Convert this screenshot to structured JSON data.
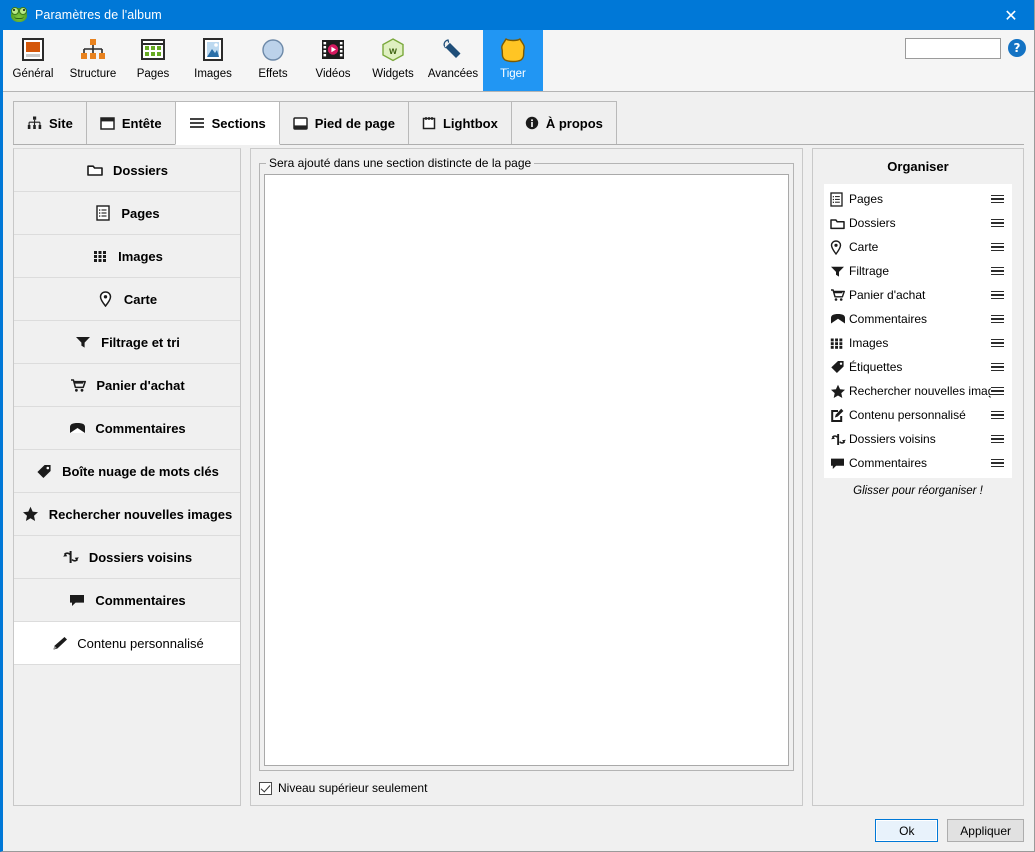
{
  "window": {
    "title": "Paramètres de l'album",
    "icon": "frog-icon",
    "close_label": "✕"
  },
  "toolbar": {
    "items": [
      {
        "label": "Général",
        "icon": "general-icon",
        "active": false
      },
      {
        "label": "Structure",
        "icon": "structure-icon",
        "active": false
      },
      {
        "label": "Pages",
        "icon": "pages-grid-icon",
        "active": false
      },
      {
        "label": "Images",
        "icon": "image-icon",
        "active": false
      },
      {
        "label": "Effets",
        "icon": "circle-icon",
        "active": false
      },
      {
        "label": "Vidéos",
        "icon": "film-icon",
        "active": false
      },
      {
        "label": "Widgets",
        "icon": "hexagon-w-icon",
        "active": false
      },
      {
        "label": "Avancées",
        "icon": "wrench-icon",
        "active": false
      },
      {
        "label": "Tiger",
        "icon": "tiger-skin-icon",
        "active": true
      }
    ],
    "search_value": "",
    "search_placeholder": "",
    "search_icon": "search-icon",
    "help_label": "?",
    "active_color": "#2196f3"
  },
  "tabs": [
    {
      "label": "Site",
      "icon": "sitemap-icon",
      "active": false
    },
    {
      "label": "Entête",
      "icon": "header-icon",
      "active": false
    },
    {
      "label": "Sections",
      "icon": "hamburger-icon",
      "active": true
    },
    {
      "label": "Pied de page",
      "icon": "footer-icon",
      "active": false
    },
    {
      "label": "Lightbox",
      "icon": "lightbox-icon",
      "active": false
    },
    {
      "label": "À propos",
      "icon": "info-icon",
      "active": false
    }
  ],
  "sidebar": {
    "items": [
      {
        "label": "Dossiers",
        "icon": "folder-icon",
        "selected": false
      },
      {
        "label": "Pages",
        "icon": "page-icon",
        "selected": false
      },
      {
        "label": "Images",
        "icon": "grid-icon",
        "selected": false
      },
      {
        "label": "Carte",
        "icon": "map-pin-icon",
        "selected": false
      },
      {
        "label": "Filtrage et tri",
        "icon": "funnel-icon",
        "selected": false
      },
      {
        "label": "Panier d'achat",
        "icon": "cart-icon",
        "selected": false
      },
      {
        "label": "Commentaires",
        "icon": "envelope-icon",
        "selected": false
      },
      {
        "label": "Boîte nuage de mots clés",
        "icon": "tag-icon",
        "selected": false
      },
      {
        "label": "Rechercher nouvelles images",
        "icon": "star-icon",
        "selected": false
      },
      {
        "label": "Dossiers voisins",
        "icon": "swap-icon",
        "selected": false
      },
      {
        "label": "Commentaires",
        "icon": "speech-icon",
        "selected": false
      },
      {
        "label": "Contenu personnalisé",
        "icon": "pencil-icon",
        "selected": true
      }
    ]
  },
  "main": {
    "group_legend": "Sera ajouté dans une section distincte de la page",
    "editor_value": "",
    "checkbox": {
      "label": "Niveau supérieur seulement",
      "checked": true
    }
  },
  "organiser": {
    "title": "Organiser",
    "hint": "Glisser pour réorganiser !",
    "items": [
      {
        "label": "Pages",
        "icon": "page-icon"
      },
      {
        "label": "Dossiers",
        "icon": "folder-icon"
      },
      {
        "label": "Carte",
        "icon": "map-pin-icon"
      },
      {
        "label": "Filtrage",
        "icon": "funnel-icon"
      },
      {
        "label": "Panier d'achat",
        "icon": "cart-icon"
      },
      {
        "label": "Commentaires",
        "icon": "envelope-icon"
      },
      {
        "label": "Images",
        "icon": "grid-icon"
      },
      {
        "label": "Étiquettes",
        "icon": "tag-icon"
      },
      {
        "label": "Rechercher nouvelles images",
        "icon": "star-icon"
      },
      {
        "label": "Contenu personnalisé",
        "icon": "pencil-square-icon"
      },
      {
        "label": "Dossiers voisins",
        "icon": "swap-icon"
      },
      {
        "label": "Commentaires",
        "icon": "speech-icon"
      }
    ]
  },
  "footer": {
    "ok_label": "Ok",
    "apply_label": "Appliquer"
  }
}
